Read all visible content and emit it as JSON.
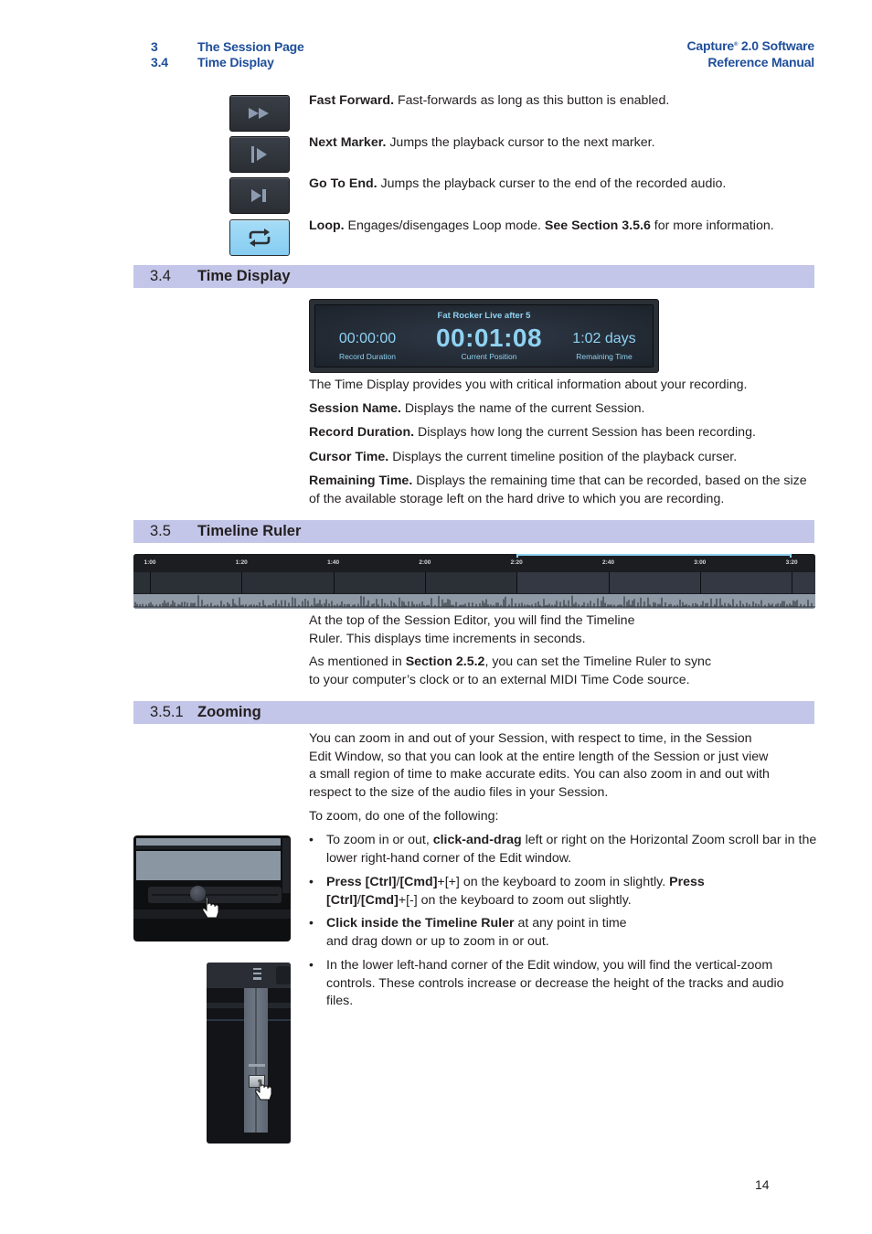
{
  "header": {
    "chapter_number": "3",
    "chapter_title": "The Session Page",
    "section_number": "3.4",
    "section_title": "Time Display",
    "product_name": "Capture",
    "product_trademark": "®",
    "product_version": " 2.0 Software",
    "manual_title": "Reference Manual"
  },
  "transport_buttons": [
    {
      "icon": "fast-forward-icon",
      "term": "Fast Forward.",
      "description": " Fast-forwards as long as this button is enabled."
    },
    {
      "icon": "next-marker-icon",
      "term": "Next Marker.",
      "description": " Jumps the playback cursor to the next marker."
    },
    {
      "icon": "go-to-end-icon",
      "term": "Go To End.",
      "description": " Jumps the playback curser to the end of the recorded audio."
    },
    {
      "icon": "loop-icon",
      "term": "Loop.",
      "description": " Engages/disengages Loop mode. ",
      "ref": "See Section 3.5.6",
      "description_after": " for more information."
    }
  ],
  "colors": {
    "section_bar": "#c3c6e8",
    "header_blue": "#1f4e9a",
    "display_text": "#8fd2f2",
    "loop_active": "#a6dcf7"
  },
  "section_34": {
    "number": "3.4",
    "title": "Time Display",
    "time_display": {
      "session_name": "Fat Rocker Live after 5",
      "record_duration_value": "00:00:00",
      "record_duration_label": "Record Duration",
      "current_position_value": "00:01:08",
      "current_position_label": "Current Position",
      "remaining_time_value": "1:02 days",
      "remaining_time_label": "Remaining Time"
    },
    "intro": "The Time Display provides you with critical information about your recording.",
    "items": [
      {
        "term": "Session Name.",
        "description": " Displays the name of the current Session."
      },
      {
        "term": "Record Duration.",
        "description": " Displays how long the current Session has been recording."
      },
      {
        "term": "Cursor Time.",
        "description": " Displays the current timeline position of the playback curser."
      },
      {
        "term": "Remaining Time.",
        "description": " Displays the remaining time that can be recorded, based on the size of the available storage left on the hard drive to which you are recording."
      }
    ]
  },
  "section_35": {
    "number": "3.5",
    "title": "Timeline Ruler",
    "ruler_ticks": [
      "1:00",
      "1:20",
      "1:40",
      "2:00",
      "2:20",
      "2:40",
      "3:00",
      "3:20"
    ],
    "loop_range": {
      "start": "2:20",
      "end": "3:20"
    },
    "para1": "At the top of the Session Editor, you will find the Timeline Ruler. This displays time increments in seconds.",
    "para2_before": "As mentioned in ",
    "para2_ref": "Section 2.5.2",
    "para2_after": ", you can set the Timeline Ruler to sync to your computer’s clock or to an external MIDI Time Code source."
  },
  "section_351": {
    "number": "3.5.1",
    "title": "Zooming",
    "para1": "You can zoom in and out of your Session, with respect to time, in the Session Edit Window, so that you can look at the entire length of the Session or just view a small region of time to make accurate edits. You can also zoom in and out with respect to the size of the audio files in your Session.",
    "para2": "To zoom, do one of the following:",
    "bullets": [
      {
        "b1_pre": "To zoom in or out, ",
        "b1_bold": "click-and-drag",
        "b1_post": " left or right on the Horizontal Zoom scroll bar in the lower right-hand corner of the Edit window."
      },
      {
        "b2_bold1": "Press [Ctrl]",
        "b2_mid1": "/",
        "b2_bold2": "[Cmd]",
        "b2_mid2": "+[+] on the keyboard to zoom in slightly. ",
        "b2_bold3": "Press [Ctrl]",
        "b2_mid3": "/",
        "b2_bold4": "[Cmd]",
        "b2_post": "+[-] on the keyboard to zoom out slightly."
      },
      {
        "b3_bold": "Click inside the Timeline Ruler",
        "b3_post": " at any point in time and drag down or up to zoom in or out."
      },
      {
        "b4": "In the lower left-hand corner of the Edit window, you will find the vertical-zoom controls. These controls increase or decrease the height of the tracks and audio files."
      }
    ],
    "bullet_char": "•"
  },
  "page_number": "14"
}
